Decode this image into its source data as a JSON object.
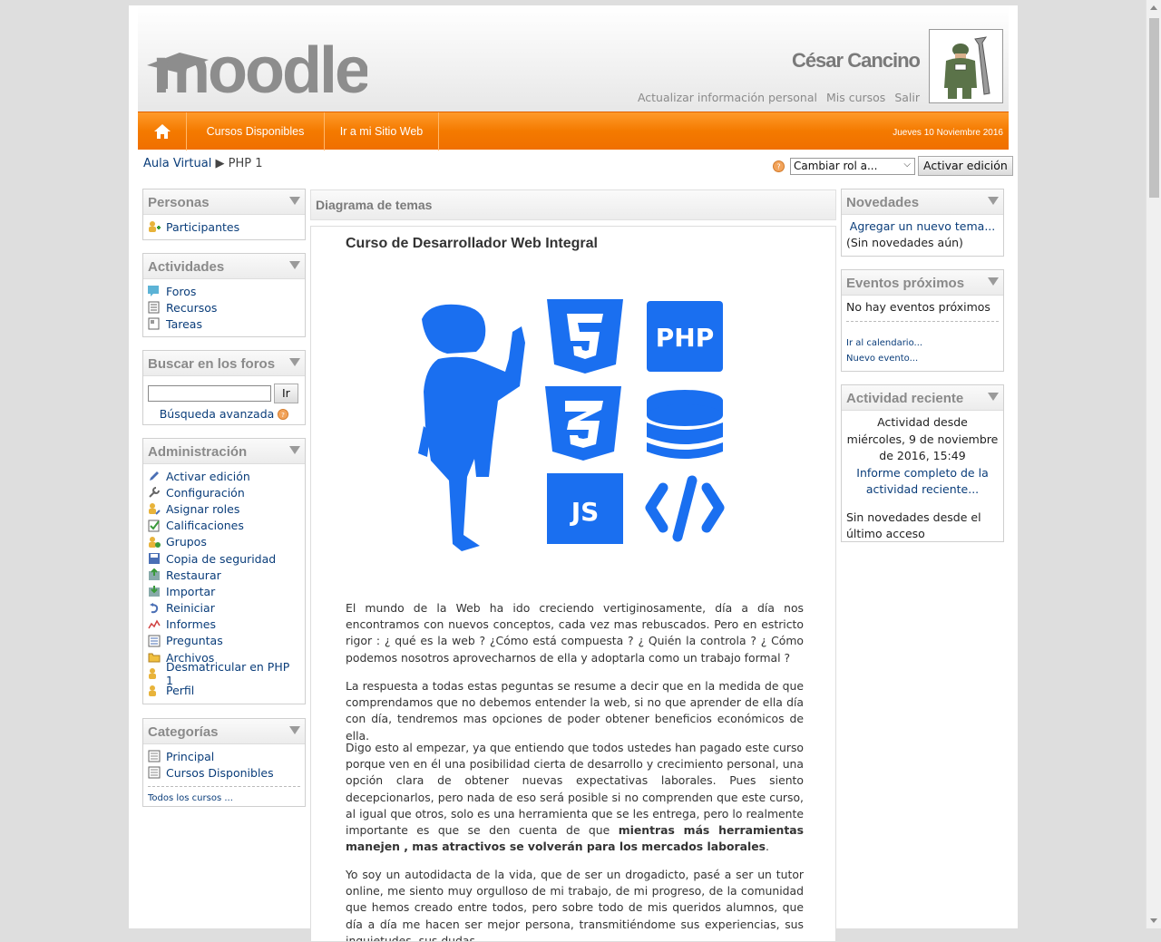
{
  "header": {
    "logo_text": "moodle",
    "user_name": "César Cancino",
    "user_links": [
      "Actualizar información personal",
      "Mis cursos",
      "Salir"
    ]
  },
  "navbar": {
    "items": [
      "Cursos Disponibles",
      "Ir a mi Sitio Web"
    ],
    "date": "Jueves 10 Noviembre 2016"
  },
  "breadcrumb": {
    "root": "Aula Virtual",
    "separator": "▶",
    "current": "PHP 1"
  },
  "role": {
    "select_value": "Cambiar rol a...",
    "edit_button": "Activar edición"
  },
  "blocks_left": {
    "personas": {
      "title": "Personas",
      "items": [
        "Participantes"
      ]
    },
    "actividades": {
      "title": "Actividades",
      "items": [
        "Foros",
        "Recursos",
        "Tareas"
      ]
    },
    "buscar": {
      "title": "Buscar en los foros",
      "button": "Ir",
      "advanced": "Búsqueda avanzada"
    },
    "admin": {
      "title": "Administración",
      "items": [
        "Activar edición",
        "Configuración",
        "Asignar roles",
        "Calificaciones",
        "Grupos",
        "Copia de seguridad",
        "Restaurar",
        "Importar",
        "Reiniciar",
        "Informes",
        "Preguntas",
        "Archivos",
        "Desmatricular en PHP 1",
        "Perfil"
      ]
    },
    "categorias": {
      "title": "Categorías",
      "items": [
        "Principal",
        "Cursos Disponibles"
      ],
      "all": "Todos los cursos ..."
    }
  },
  "main": {
    "header": "Diagrama de temas",
    "course_title": "Curso de Desarrollador Web Integral",
    "hero_icons": [
      "PHP",
      "JS"
    ],
    "paragraphs": [
      "El mundo de la Web ha ido creciendo vertiginosamente, día a día nos encontramos con nuevos conceptos, cada vez mas rebuscados. Pero en estricto rigor : ¿ qué es la web ? ¿Cómo está compuesta ? ¿ Quién la controla ? ¿ Cómo podemos nosotros aprovecharnos de ella y adoptarla como un trabajo formal ?",
      "La respuesta a todas estas peguntas se resume a decir que en la medida de que comprendamos que no debemos entender la web, si no que aprender de ella día con día, tendremos mas opciones de poder obtener beneficios económicos de ella.",
      "Digo esto al empezar, ya que entiendo que todos ustedes han pagado este curso porque ven en él una posibilidad cierta de desarrollo y crecimiento personal, una opción clara de obtener nuevas expectativas laborales. Pues siento decepcionarlos, pero nada de eso será posible si no comprenden que este curso, al igual que otros, solo es una herramienta que se les entrega, pero lo realmente importante es que se den cuenta de que ",
      "mientras más herramientas manejen , mas atractivos se volverán para los mercados laborales",
      ".",
      "Yo soy un autodidacta de la vida, que de ser un drogadicto, pasé a ser un tutor online, me siento muy orgulloso de mi trabajo, de mi progreso, de la comunidad que hemos creado entre todos, pero sobre todo de mis queridos alumnos, que día a día me hacen ser mejor persona, transmitiéndome sus experiencias, sus inquietudes, sus dudas"
    ]
  },
  "blocks_right": {
    "novedades": {
      "title": "Novedades",
      "link": "Agregar un nuevo tema...",
      "text": "(Sin novedades aún)"
    },
    "eventos": {
      "title": "Eventos próximos",
      "text": "No hay eventos próximos",
      "links": [
        "Ir al calendario...",
        "Nuevo evento..."
      ]
    },
    "actividad": {
      "title": "Actividad reciente",
      "since": "Actividad desde miércoles, 9 de noviembre de 2016, 15:49",
      "link": "Informe completo de la actividad reciente...",
      "none": "Sin novedades desde el último acceso"
    }
  },
  "colors": {
    "accent": "#f47a00",
    "link": "#0a3d7a",
    "hero_blue": "#1a6ff0"
  }
}
